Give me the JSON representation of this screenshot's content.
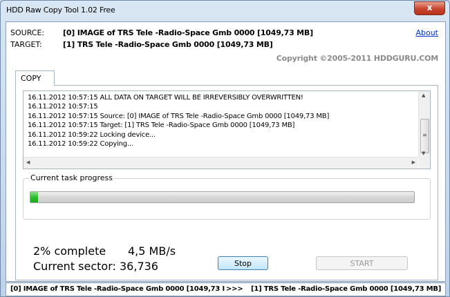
{
  "window": {
    "title": "HDD Raw Copy Tool 1.02   Free",
    "close_glyph": "x"
  },
  "header": {
    "source_label": "SOURCE:",
    "source_value": "[0]  IMAGE of TRS Tele -Radio-Space Gmb  0000  [1049,73 MB]",
    "target_label": "TARGET:",
    "target_value": "[1]  TRS Tele -Radio-Space Gmb  0000  [1049,73 MB]",
    "about_link": "About",
    "copyright": "Copyright ©2005-2011 HDDGURU.COM"
  },
  "tabs": [
    {
      "label": "COPY",
      "active": true
    }
  ],
  "log": {
    "lines": [
      "16.11.2012 10:57:15  ALL DATA ON TARGET WILL BE IRREVERSIBLY OVERWRITTEN!",
      "16.11.2012 10:57:15",
      "16.11.2012 10:57:15  Source: [0]  IMAGE of TRS Tele -Radio-Space Gmb   0000   [1049,73 MB]",
      "16.11.2012 10:57:15  Target: [1]  TRS Tele -Radio-Space Gmb   0000   [1049,73 MB]",
      "16.11.2012 10:59:22  Locking device...",
      "16.11.2012 10:59:22  Copying..."
    ]
  },
  "progress": {
    "group_label": "Current task progress",
    "fraction": 0.02,
    "fill_color": "#2fbf2f"
  },
  "stats": {
    "percent_text": "2% complete",
    "speed_text": "4,5 MB/s",
    "sector_text": "Current sector: 36,736"
  },
  "buttons": {
    "stop": "Stop",
    "start": "START"
  },
  "statusbar": {
    "source": "[0]  IMAGE of TRS Tele -Radio-Space Gmb   0000   [1049,73 I",
    "arrow": ">>>",
    "target": "[1]  TRS Tele -Radio-Space Gmb   0000   [1049,73 MB]"
  },
  "icons": {
    "close": "close-icon",
    "scroll_up": "scroll-up-arrow-icon",
    "scroll_down": "scroll-down-arrow-icon",
    "scroll_left": "scroll-left-arrow-icon",
    "scroll_right": "scroll-right-arrow-icon"
  },
  "colors": {
    "link": "#0033cc",
    "copyright": "#8a8a8a",
    "close_button": "#c7442d"
  }
}
